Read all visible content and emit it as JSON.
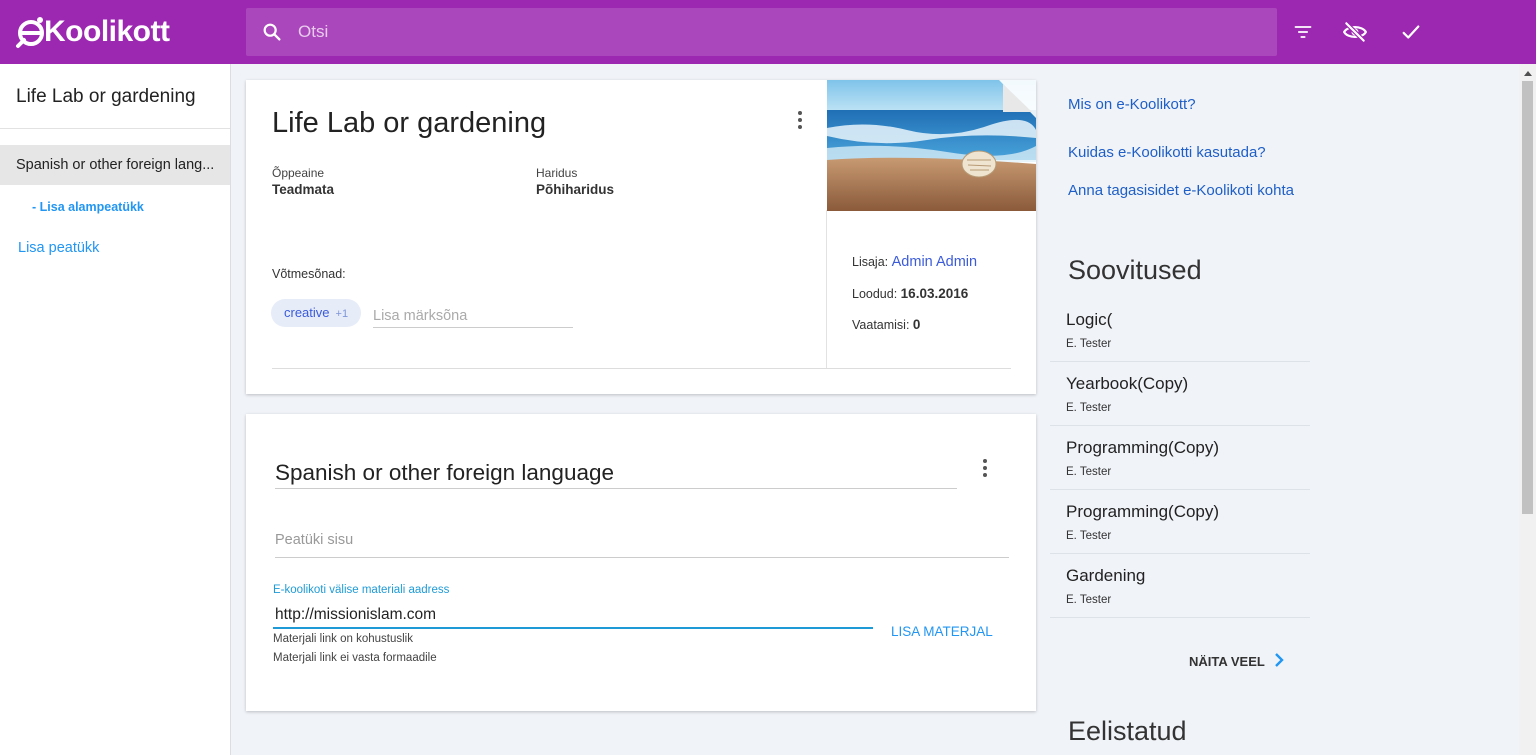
{
  "header": {
    "logo_text": "Koolikott",
    "search_placeholder": "Otsi",
    "icons": [
      "search-icon",
      "filter-icon",
      "visibility-off-icon",
      "check-icon"
    ],
    "brand_color": "#9c27b0"
  },
  "sidebar": {
    "title": "Life Lab or gardening",
    "chapter": "Spanish or other foreign lang...",
    "add_subchapter": "- Lisa alampeatükk",
    "add_chapter": "Lisa peatükk"
  },
  "portfolio": {
    "title": "Life Lab or gardening",
    "subject_label": "Õppeaine",
    "subject_value": "Teadmata",
    "education_label": "Haridus",
    "education_value": "Põhiharidus",
    "keywords_label": "Võtmesõnad:",
    "keyword_chip": "creative",
    "keyword_more": "+1",
    "keyword_placeholder": "Lisa märksõna",
    "creator_label": "Lisaja:",
    "creator_name": "Admin Admin",
    "created_label": "Loodud:",
    "created_date": "16.03.2016",
    "views_label": "Vaatamisi:",
    "views_count": "0"
  },
  "chapter_card": {
    "title": "Spanish or other foreign language",
    "content_placeholder": "Peatüki sisu",
    "url_label": "E-koolikoti välise materiali aadress",
    "url_value": "http://missionislam.com",
    "hint_required": "Materjali link on kohustuslik",
    "hint_format": "Materjali link ei vasta formaadile",
    "add_material": "LISA MATERJAL"
  },
  "right": {
    "links": [
      "Mis on e-Koolikott?",
      "Kuidas e-Koolikotti kasutada?",
      "Anna tagasisidet e-Koolikoti kohta"
    ],
    "recommendations_heading": "Soovitused",
    "recommendations": [
      {
        "title": "Logic(",
        "author": "E. Tester"
      },
      {
        "title": "Yearbook(Copy)",
        "author": "E. Tester"
      },
      {
        "title": "Programming(Copy)",
        "author": "E. Tester"
      },
      {
        "title": "Programming(Copy)",
        "author": "E. Tester"
      },
      {
        "title": "Gardening",
        "author": "E. Tester"
      }
    ],
    "show_more": "NÄITA VEEL",
    "favorites_heading": "Eelistatud"
  }
}
